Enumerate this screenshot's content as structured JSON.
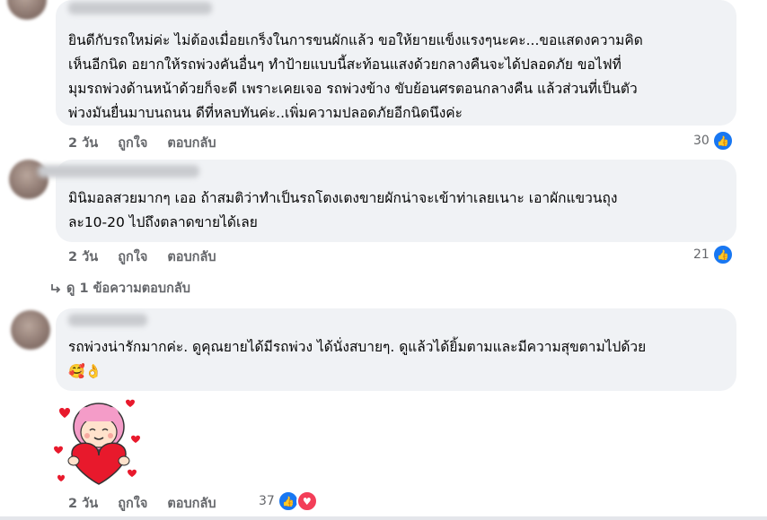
{
  "comments": [
    {
      "text": "ยินดีกับรถใหม่ค่ะ ไม่ต้องเมื่อยเกร็งในการขนผักแล้ว ขอให้ยายแข็งแรงๆนะคะ...ขอแสดงความคิด\nเห็นอีกนิด อยากให้รถพ่วงคันอื่นๆ ทำป้ายแบบนี้สะท้อนแสงด้วยกลางคืนจะได้ปลอดภัย ขอไฟที่\nมุมรถพ่วงด้านหน้าด้วยก็จะดี เพราะเคยเจอ รถพ่วงข้าง ขับย้อนศรตอนกลางคืน แล้วส่วนที่เป็นตัว\nพ่วงมันยื่นมาบนถนน ดีที่หลบทันค่ะ..เพิ่มความปลอดภัยอีกนิดนึงค่ะ",
      "time": "2 วัน",
      "like": "ถูกใจ",
      "reply": "ตอบกลับ",
      "reactions": "30"
    },
    {
      "text": "มินิมอลสวยมากๆ เออ ถ้าสมติว่าทำเป็นรถโตงเตงขายผักน่าจะเข้าท่าเลยเนาะ เอาผักแขวนถุง\nละ10-20 ไปถึงตลาดขายได้เลย",
      "time": "2 วัน",
      "like": "ถูกใจ",
      "reply": "ตอบกลับ",
      "reactions": "21",
      "view_replies": "ดู 1 ข้อความตอบกลับ"
    },
    {
      "text": "รถพ่วงน่ารักมากค่ะ. ดูคุณยายได้มีรถพ่วง ได้นั่งสบายๆ. ดูแล้วได้ยิ้มตามและมีความสุขตามไปด้วย",
      "emoji": "🥰👌",
      "time": "2 วัน",
      "like": "ถูกใจ",
      "reply": "ตอบกลับ",
      "reactions": "37"
    }
  ],
  "icons": {
    "like": "like-icon",
    "love": "love-icon",
    "reply_arrow": "reply-arrow-icon",
    "sticker": "girl-holding-heart-sticker"
  },
  "colors": {
    "bubble": "#f0f2f5",
    "like_blue": "#1877f2",
    "love_red": "#f33e58",
    "meta_gray": "#65676b"
  }
}
